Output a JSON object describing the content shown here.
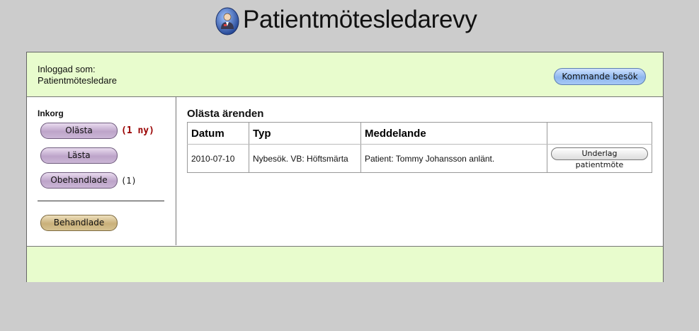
{
  "app": {
    "title": "Patientmötesledarevy",
    "logo_icon": "person-badge-icon"
  },
  "topbar": {
    "login_label": "Inloggad som:",
    "login_user": "Patientmötesledare",
    "upcoming_visits_button": "Kommande besök"
  },
  "sidebar": {
    "inbox_heading": "Inkorg",
    "items": [
      {
        "label": "Olästa",
        "badge": "(1 ny)"
      },
      {
        "label": "Lästa"
      },
      {
        "label": "Obehandlade",
        "badge": "(1)"
      },
      {
        "label": "Behandlade"
      }
    ]
  },
  "main": {
    "section_title": "Olästa ärenden",
    "table": {
      "columns": [
        "Datum",
        "Typ",
        "Meddelande",
        ""
      ],
      "rows": [
        {
          "date": "2010-07-10",
          "type": "Nybesök. VB: Höftsmärta",
          "message": "Patient: Tommy Johansson anlänt.",
          "action": "Underlag patientmöte"
        }
      ]
    }
  },
  "colors": {
    "page_bg": "#cccccc",
    "panel_green": "#e8fccd",
    "alert_red": "#990000",
    "pill_purple": "#bda4c9",
    "pill_gold": "#c9b07a",
    "button_blue": "#8eb6ee"
  }
}
